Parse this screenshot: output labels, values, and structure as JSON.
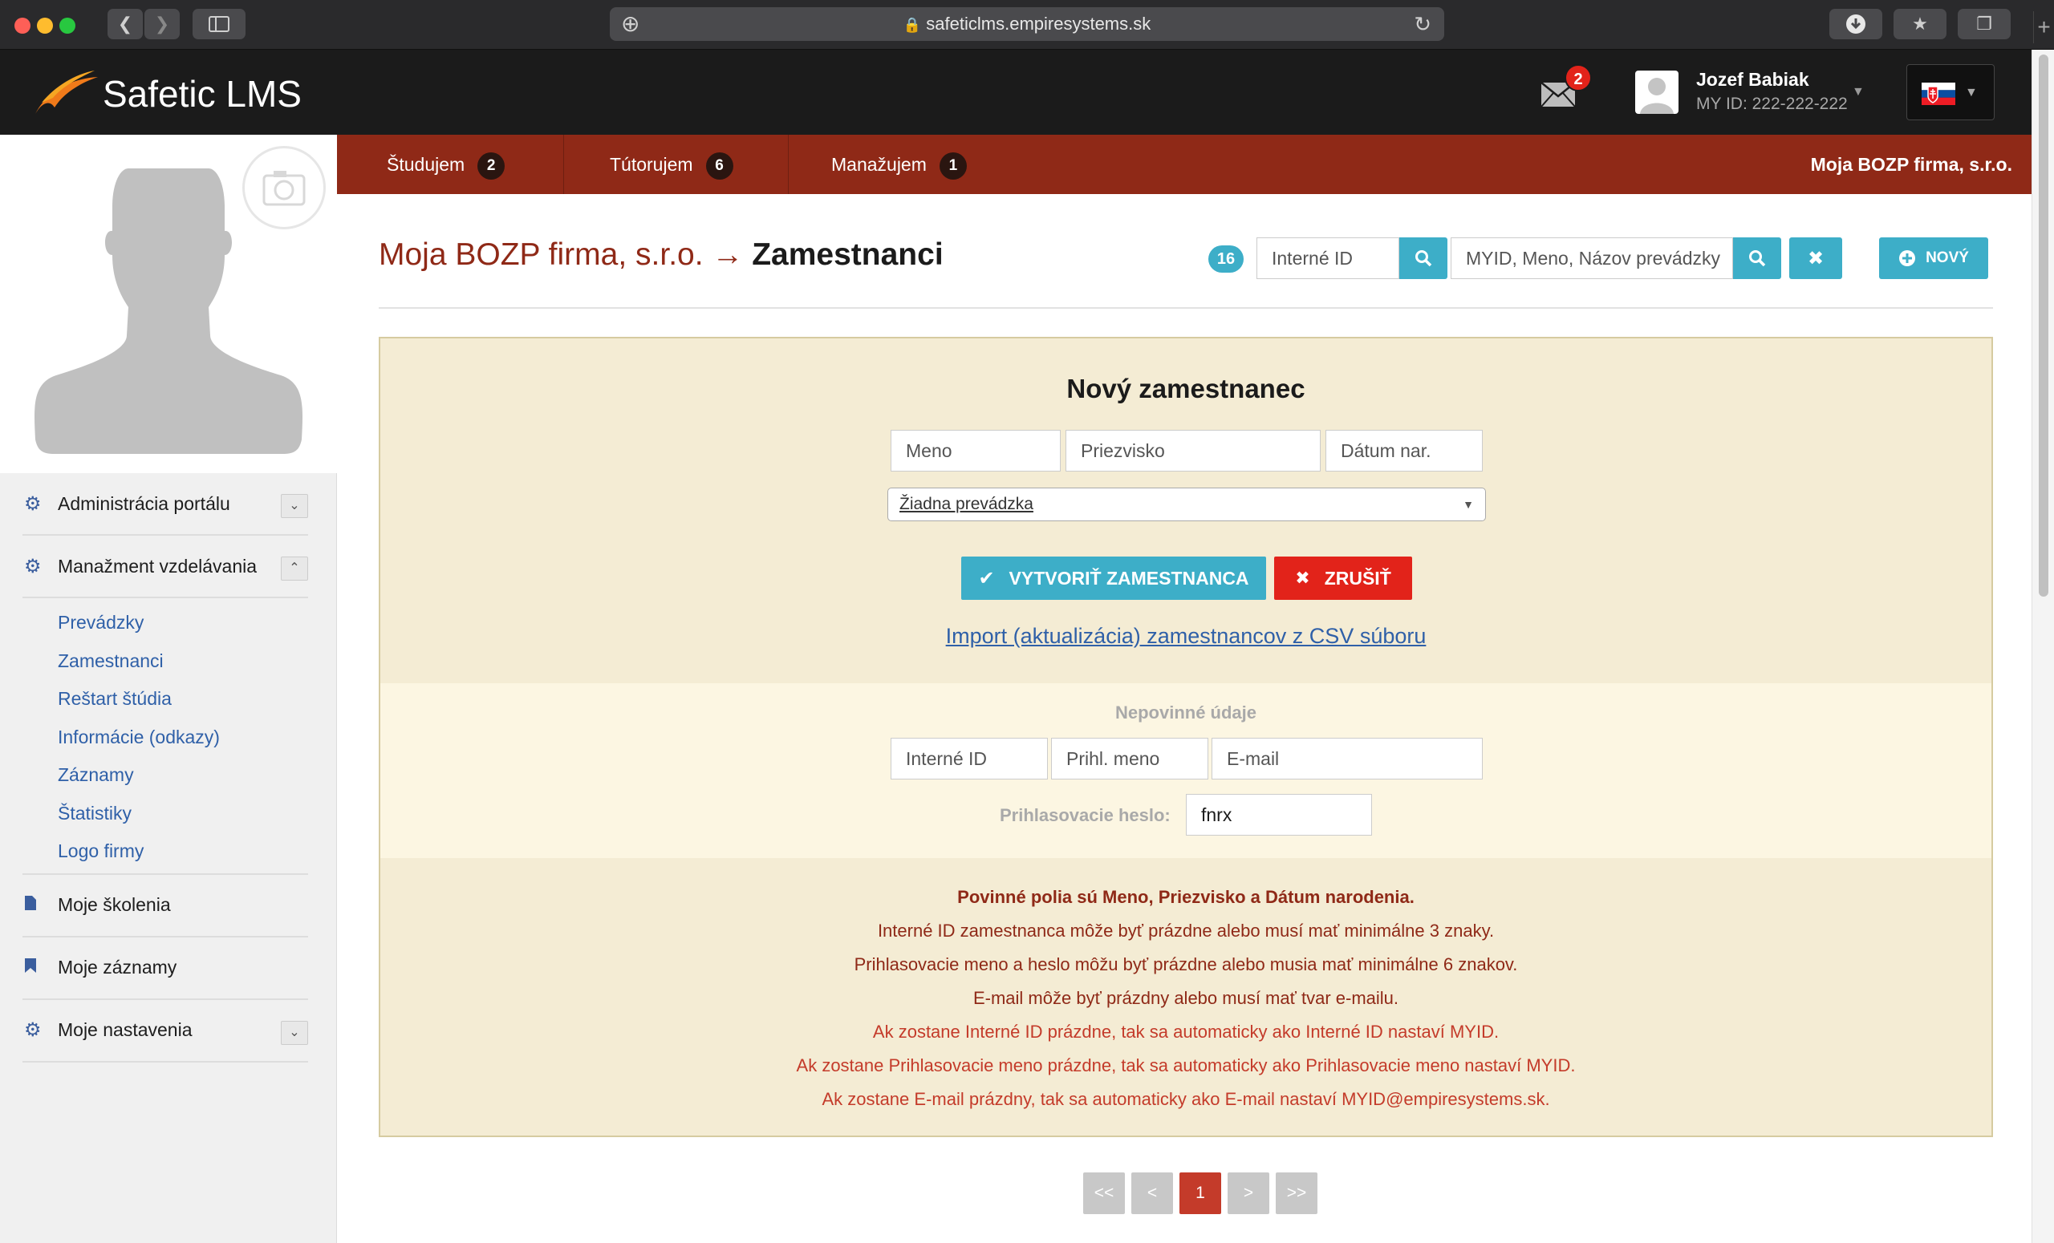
{
  "browser": {
    "url": "safeticlms.empiresystems.sk"
  },
  "header": {
    "logo_text": "Safetic LMS",
    "mail_count": "2",
    "user_name": "Jozef Babiak",
    "user_id": "MY ID: 222-222-222"
  },
  "sidebar": {
    "menu": [
      {
        "label": "Administrácia portálu"
      },
      {
        "label": "Manažment vzdelávania"
      }
    ],
    "submenu": [
      "Prevádzky",
      "Zamestnanci",
      "Reštart štúdia",
      "Informácie (odkazy)",
      "Záznamy",
      "Štatistiky",
      "Logo firmy"
    ],
    "bottom": [
      {
        "label": "Moje školenia"
      },
      {
        "label": "Moje záznamy"
      },
      {
        "label": "Moje nastavenia"
      }
    ]
  },
  "topnav": {
    "tabs": [
      {
        "label": "Študujem",
        "count": "2"
      },
      {
        "label": "Tútorujem",
        "count": "6"
      },
      {
        "label": "Manažujem",
        "count": "1"
      }
    ],
    "company": "Moja BOZP firma, s.r.o."
  },
  "page": {
    "title_prefix": "Moja BOZP firma, s.r.o. →",
    "title_main": "Zamestnanci",
    "count": "16",
    "search_id_placeholder": "Interné ID",
    "search_text_placeholder": "MYID, Meno, Názov prevádzky",
    "new_label": "NOVÝ"
  },
  "form": {
    "title": "Nový zamestnanec",
    "first_name_placeholder": "Meno",
    "last_name_placeholder": "Priezvisko",
    "dob_placeholder": "Dátum nar.",
    "branch_selected": "Žiadna prevádzka",
    "create_label": "VYTVORIŤ ZAMESTNANCA",
    "cancel_label": "ZRUŠIŤ",
    "import_link": "Import (aktualizácia) zamestnancov z CSV súboru",
    "optional_title": "Nepovinné údaje",
    "internal_id_placeholder": "Interné ID",
    "login_placeholder": "Prihl. meno",
    "email_placeholder": "E-mail",
    "password_label": "Prihlasovacie heslo:",
    "password_value": "fnrx",
    "notes": [
      "Povinné polia sú Meno, Priezvisko a Dátum narodenia.",
      "Interné ID zamestnanca môže byť prázdne alebo musí mať minimálne 3 znaky.",
      "Prihlasovacie meno a heslo môžu byť prázdne alebo musia mať minimálne 6 znakov.",
      "E-mail môže byť prázdny alebo musí mať tvar e-mailu.",
      "Ak zostane Interné ID prázdne, tak sa automaticky ako Interné ID nastaví MYID.",
      "Ak zostane Prihlasovacie meno prázdne, tak sa automaticky ako Prihlasovacie meno nastaví MYID.",
      "Ak zostane E-mail prázdny, tak sa automaticky ako E-mail nastaví MYID@empiresystems.sk."
    ]
  },
  "pager": {
    "first": "<<",
    "prev": "<",
    "current": "1",
    "next": ">",
    "last": ">>"
  },
  "colors": {
    "accent": "#3daec8",
    "brand": "#8f2917",
    "danger": "#e2231a",
    "panel": "#f4ecd4"
  }
}
